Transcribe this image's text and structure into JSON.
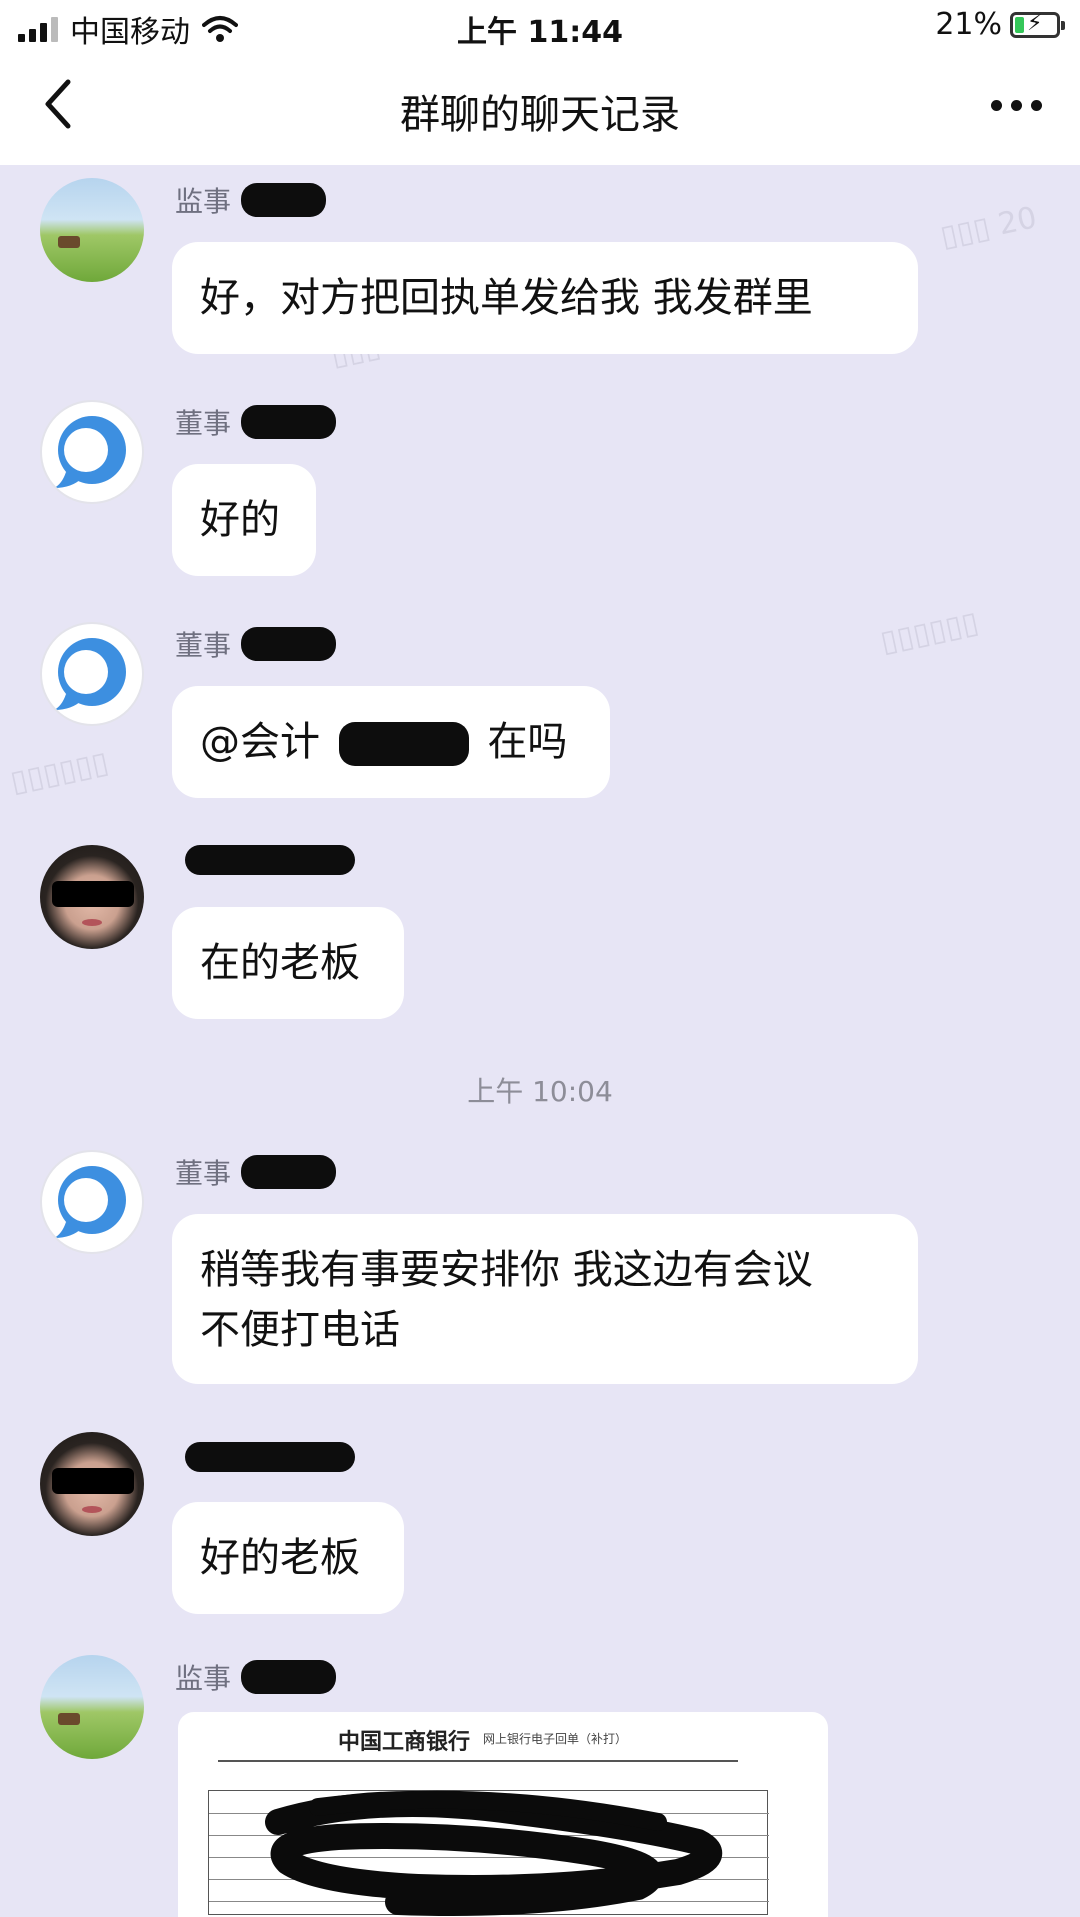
{
  "status_bar": {
    "carrier": "中国移动",
    "time": "上午 11:44",
    "battery": "21%",
    "battery_level": 0.21
  },
  "nav": {
    "title": "群聊的聊天记录"
  },
  "messages": [
    {
      "sender": "监事",
      "text": "好，对方把回执单发给我 我发群里"
    },
    {
      "sender": "董事",
      "text": "好的"
    },
    {
      "sender": "董事",
      "text_prefix": "@会计",
      "text_suffix": "在吗"
    },
    {
      "sender": "",
      "text": "在的老板"
    },
    {
      "sender": "董事",
      "text_line1": "稍等我有事要安排你 我这边有会议",
      "text_line2": "不便打电话"
    },
    {
      "sender": "",
      "text": "好的老板"
    },
    {
      "sender": "监事"
    }
  ],
  "timestamp": "上午 10:04",
  "receipt": {
    "bank_name": "中国工商银行",
    "subtitle": "网上银行电子回单（补打）"
  },
  "colors": {
    "background": "#e7e5f5",
    "bubble": "#ffffff",
    "battery_fill": "#35c759"
  },
  "icons": [
    "signal-icon",
    "wifi-icon",
    "battery-icon",
    "back-chevron-icon",
    "more-dots-icon"
  ]
}
